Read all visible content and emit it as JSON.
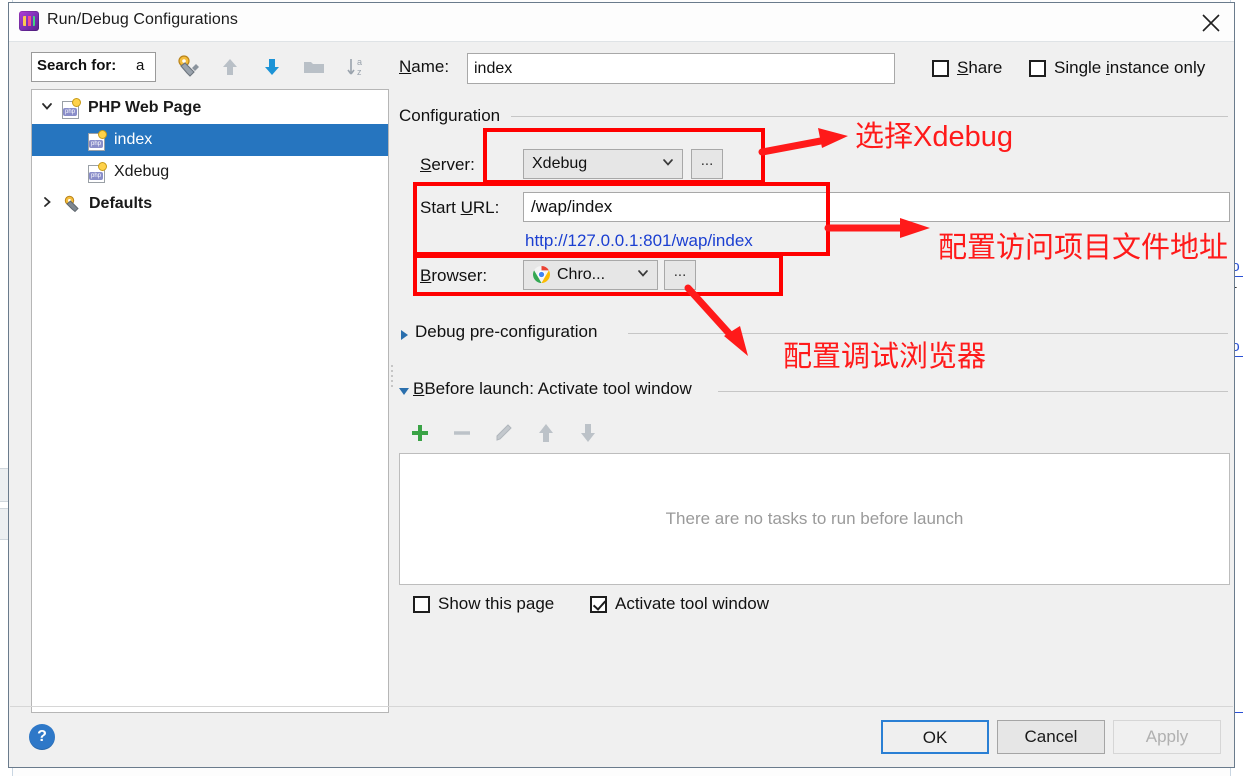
{
  "window": {
    "title": "Run/Debug Configurations",
    "app_icon": "phpstorm-icon",
    "close_icon": "close-icon"
  },
  "sidebar": {
    "search": {
      "label": "Search for:",
      "value": "a"
    },
    "toolbar": [
      {
        "name": "edit-templates-icon",
        "title": "Edit configuration templates"
      },
      {
        "name": "move-up-icon",
        "title": "Move Up"
      },
      {
        "name": "move-down-icon",
        "title": "Move Down"
      },
      {
        "name": "folder-icon",
        "title": "Create new folder"
      },
      {
        "name": "sort-alphabetically-icon",
        "title": "Sort configurations"
      }
    ],
    "tree": [
      {
        "label": "PHP Web Page",
        "level": 0,
        "expanded": true,
        "bold": true,
        "icon": "php-file-icon",
        "selected": false
      },
      {
        "label": "index",
        "level": 1,
        "expanded": null,
        "bold": false,
        "icon": "php-file-icon",
        "selected": true
      },
      {
        "label": "Xdebug",
        "level": 1,
        "expanded": null,
        "bold": false,
        "icon": "php-file-icon",
        "selected": false
      },
      {
        "label": "Defaults",
        "level": 0,
        "expanded": false,
        "bold": true,
        "icon": "defaults-gear-icon",
        "selected": false
      }
    ]
  },
  "header": {
    "name_label": "Name:",
    "name_value": "index",
    "share_label": "Share",
    "share_checked": false,
    "single_instance_label": "Single instance only",
    "single_instance_checked": false
  },
  "configuration": {
    "group_title": "Configuration",
    "server_label": "Server:",
    "server_value": "Xdebug",
    "server_browse_label": "...",
    "start_url_label": "Start URL:",
    "start_url_value": "/wap/index",
    "url_preview": "http://127.0.0.1:801/wap/index",
    "browser_label": "Browser:",
    "browser_value": "Chro...",
    "browser_browse_label": "...",
    "browser_icon": "chrome-icon"
  },
  "debug_preconfig": {
    "title": "Debug pre-configuration",
    "expanded": false
  },
  "before_launch": {
    "title": "Before launch: Activate tool window",
    "expanded": true,
    "toolbar": [
      {
        "name": "add-task-icon",
        "label": "+",
        "enabled": true
      },
      {
        "name": "remove-task-icon",
        "label": "−",
        "enabled": false
      },
      {
        "name": "edit-task-icon",
        "label": "pencil",
        "enabled": false
      },
      {
        "name": "move-task-up-icon",
        "label": "up",
        "enabled": false
      },
      {
        "name": "move-task-down-icon",
        "label": "down",
        "enabled": false
      }
    ],
    "empty_text": "There are no tasks to run before launch",
    "show_page_label": "Show this page",
    "show_page_checked": false,
    "activate_tool_window_label": "Activate tool window",
    "activate_tool_window_checked": true
  },
  "footer": {
    "help_label": "?",
    "ok_label": "OK",
    "cancel_label": "Cancel",
    "apply_label": "Apply",
    "apply_enabled": false
  },
  "annotations": {
    "note1": "选择Xdebug",
    "note2": "配置访问项目文件地址",
    "note3": "配置调试浏览器",
    "color": "#ff1a1a"
  },
  "background": {
    "fragment_a": "lo",
    "fragment_b": "lo",
    "fragment_c": "T"
  }
}
